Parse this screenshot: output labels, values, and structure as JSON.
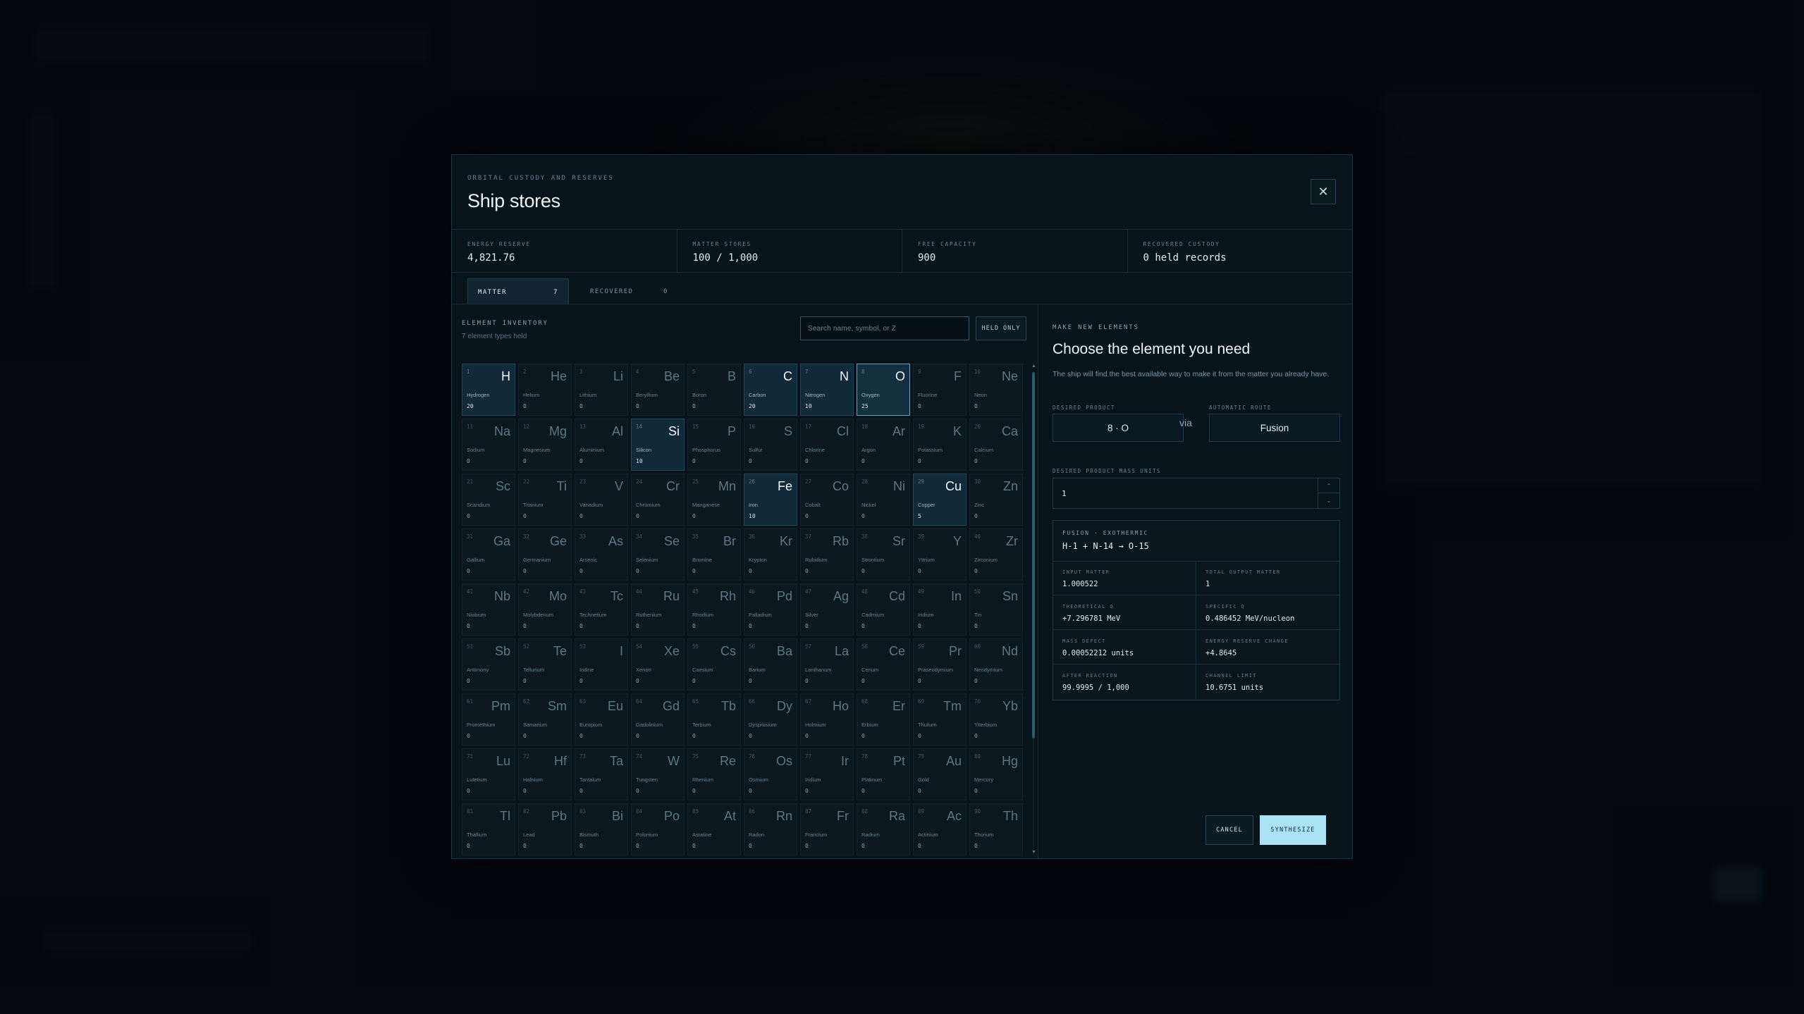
{
  "header": {
    "eyebrow": "ORBITAL CUSTODY AND RESERVES",
    "title": "Ship stores",
    "close_symbol": "✕"
  },
  "stats": [
    {
      "label": "ENERGY RESERVE",
      "value": "4,821.76"
    },
    {
      "label": "MATTER STORES",
      "value": "100 / 1,000"
    },
    {
      "label": "FREE CAPACITY",
      "value": "900"
    },
    {
      "label": "RECOVERED CUSTODY",
      "value": "0 held records"
    }
  ],
  "tabs": [
    {
      "label": "MATTER",
      "count": "7"
    },
    {
      "label": "RECOVERED",
      "count": "0"
    }
  ],
  "inventory": {
    "label": "ELEMENT INVENTORY",
    "sublabel": "7 element types held",
    "search_placeholder": "Search name, symbol, or Z",
    "held_only_label": "HELD ONLY",
    "elements": [
      {
        "z": "1",
        "sym": "H",
        "name": "Hydrogen",
        "qty": "20",
        "state": "held"
      },
      {
        "z": "2",
        "sym": "He",
        "name": "Helium",
        "qty": "0"
      },
      {
        "z": "3",
        "sym": "Li",
        "name": "Lithium",
        "qty": "0"
      },
      {
        "z": "4",
        "sym": "Be",
        "name": "Beryllium",
        "qty": "0"
      },
      {
        "z": "5",
        "sym": "B",
        "name": "Boron",
        "qty": "0"
      },
      {
        "z": "6",
        "sym": "C",
        "name": "Carbon",
        "qty": "20",
        "state": "held"
      },
      {
        "z": "7",
        "sym": "N",
        "name": "Nitrogen",
        "qty": "10",
        "state": "held"
      },
      {
        "z": "8",
        "sym": "O",
        "name": "Oxygen",
        "qty": "25",
        "state": "selected"
      },
      {
        "z": "9",
        "sym": "F",
        "name": "Fluorine",
        "qty": "0"
      },
      {
        "z": "10",
        "sym": "Ne",
        "name": "Neon",
        "qty": "0"
      },
      {
        "z": "11",
        "sym": "Na",
        "name": "Sodium",
        "qty": "0"
      },
      {
        "z": "12",
        "sym": "Mg",
        "name": "Magnesium",
        "qty": "0"
      },
      {
        "z": "13",
        "sym": "Al",
        "name": "Aluminium",
        "qty": "0"
      },
      {
        "z": "14",
        "sym": "Si",
        "name": "Silicon",
        "qty": "10",
        "state": "held"
      },
      {
        "z": "15",
        "sym": "P",
        "name": "Phosphorus",
        "qty": "0"
      },
      {
        "z": "16",
        "sym": "S",
        "name": "Sulfur",
        "qty": "0"
      },
      {
        "z": "17",
        "sym": "Cl",
        "name": "Chlorine",
        "qty": "0"
      },
      {
        "z": "18",
        "sym": "Ar",
        "name": "Argon",
        "qty": "0"
      },
      {
        "z": "19",
        "sym": "K",
        "name": "Potassium",
        "qty": "0"
      },
      {
        "z": "20",
        "sym": "Ca",
        "name": "Calcium",
        "qty": "0"
      },
      {
        "z": "21",
        "sym": "Sc",
        "name": "Scandium",
        "qty": "0"
      },
      {
        "z": "22",
        "sym": "Ti",
        "name": "Titanium",
        "qty": "0"
      },
      {
        "z": "23",
        "sym": "V",
        "name": "Vanadium",
        "qty": "0"
      },
      {
        "z": "24",
        "sym": "Cr",
        "name": "Chromium",
        "qty": "0"
      },
      {
        "z": "25",
        "sym": "Mn",
        "name": "Manganese",
        "qty": "0"
      },
      {
        "z": "26",
        "sym": "Fe",
        "name": "Iron",
        "qty": "10",
        "state": "held"
      },
      {
        "z": "27",
        "sym": "Co",
        "name": "Cobalt",
        "qty": "0"
      },
      {
        "z": "28",
        "sym": "Ni",
        "name": "Nickel",
        "qty": "0"
      },
      {
        "z": "29",
        "sym": "Cu",
        "name": "Copper",
        "qty": "5",
        "state": "held"
      },
      {
        "z": "30",
        "sym": "Zn",
        "name": "Zinc",
        "qty": "0"
      },
      {
        "z": "31",
        "sym": "Ga",
        "name": "Gallium",
        "qty": "0"
      },
      {
        "z": "32",
        "sym": "Ge",
        "name": "Germanium",
        "qty": "0"
      },
      {
        "z": "33",
        "sym": "As",
        "name": "Arsenic",
        "qty": "0"
      },
      {
        "z": "34",
        "sym": "Se",
        "name": "Selenium",
        "qty": "0"
      },
      {
        "z": "35",
        "sym": "Br",
        "name": "Bromine",
        "qty": "0"
      },
      {
        "z": "36",
        "sym": "Kr",
        "name": "Krypton",
        "qty": "0"
      },
      {
        "z": "37",
        "sym": "Rb",
        "name": "Rubidium",
        "qty": "0"
      },
      {
        "z": "38",
        "sym": "Sr",
        "name": "Strontium",
        "qty": "0"
      },
      {
        "z": "39",
        "sym": "Y",
        "name": "Yttrium",
        "qty": "0"
      },
      {
        "z": "40",
        "sym": "Zr",
        "name": "Zirconium",
        "qty": "0"
      },
      {
        "z": "41",
        "sym": "Nb",
        "name": "Niobium",
        "qty": "0"
      },
      {
        "z": "42",
        "sym": "Mo",
        "name": "Molybdenum",
        "qty": "0"
      },
      {
        "z": "43",
        "sym": "Tc",
        "name": "Technetium",
        "qty": "0"
      },
      {
        "z": "44",
        "sym": "Ru",
        "name": "Ruthenium",
        "qty": "0"
      },
      {
        "z": "45",
        "sym": "Rh",
        "name": "Rhodium",
        "qty": "0"
      },
      {
        "z": "46",
        "sym": "Pd",
        "name": "Palladium",
        "qty": "0"
      },
      {
        "z": "47",
        "sym": "Ag",
        "name": "Silver",
        "qty": "0"
      },
      {
        "z": "48",
        "sym": "Cd",
        "name": "Cadmium",
        "qty": "0"
      },
      {
        "z": "49",
        "sym": "In",
        "name": "Indium",
        "qty": "0"
      },
      {
        "z": "50",
        "sym": "Sn",
        "name": "Tin",
        "qty": "0"
      },
      {
        "z": "51",
        "sym": "Sb",
        "name": "Antimony",
        "qty": "0"
      },
      {
        "z": "52",
        "sym": "Te",
        "name": "Tellurium",
        "qty": "0"
      },
      {
        "z": "53",
        "sym": "I",
        "name": "Iodine",
        "qty": "0"
      },
      {
        "z": "54",
        "sym": "Xe",
        "name": "Xenon",
        "qty": "0"
      },
      {
        "z": "55",
        "sym": "Cs",
        "name": "Caesium",
        "qty": "0"
      },
      {
        "z": "56",
        "sym": "Ba",
        "name": "Barium",
        "qty": "0"
      },
      {
        "z": "57",
        "sym": "La",
        "name": "Lanthanum",
        "qty": "0"
      },
      {
        "z": "58",
        "sym": "Ce",
        "name": "Cerium",
        "qty": "0"
      },
      {
        "z": "59",
        "sym": "Pr",
        "name": "Praseodymium",
        "qty": "0"
      },
      {
        "z": "60",
        "sym": "Nd",
        "name": "Neodymium",
        "qty": "0"
      },
      {
        "z": "61",
        "sym": "Pm",
        "name": "Promethium",
        "qty": "0"
      },
      {
        "z": "62",
        "sym": "Sm",
        "name": "Samarium",
        "qty": "0"
      },
      {
        "z": "63",
        "sym": "Eu",
        "name": "Europium",
        "qty": "0"
      },
      {
        "z": "64",
        "sym": "Gd",
        "name": "Gadolinium",
        "qty": "0"
      },
      {
        "z": "65",
        "sym": "Tb",
        "name": "Terbium",
        "qty": "0"
      },
      {
        "z": "66",
        "sym": "Dy",
        "name": "Dysprosium",
        "qty": "0"
      },
      {
        "z": "67",
        "sym": "Ho",
        "name": "Holmium",
        "qty": "0"
      },
      {
        "z": "68",
        "sym": "Er",
        "name": "Erbium",
        "qty": "0"
      },
      {
        "z": "69",
        "sym": "Tm",
        "name": "Thulium",
        "qty": "0"
      },
      {
        "z": "70",
        "sym": "Yb",
        "name": "Ytterbium",
        "qty": "0"
      },
      {
        "z": "71",
        "sym": "Lu",
        "name": "Lutetium",
        "qty": "0"
      },
      {
        "z": "72",
        "sym": "Hf",
        "name": "Hafnium",
        "qty": "0"
      },
      {
        "z": "73",
        "sym": "Ta",
        "name": "Tantalum",
        "qty": "0"
      },
      {
        "z": "74",
        "sym": "W",
        "name": "Tungsten",
        "qty": "0"
      },
      {
        "z": "75",
        "sym": "Re",
        "name": "Rhenium",
        "qty": "0"
      },
      {
        "z": "76",
        "sym": "Os",
        "name": "Osmium",
        "qty": "0"
      },
      {
        "z": "77",
        "sym": "Ir",
        "name": "Iridium",
        "qty": "0"
      },
      {
        "z": "78",
        "sym": "Pt",
        "name": "Platinum",
        "qty": "0"
      },
      {
        "z": "79",
        "sym": "Au",
        "name": "Gold",
        "qty": "0"
      },
      {
        "z": "80",
        "sym": "Hg",
        "name": "Mercury",
        "qty": "0"
      },
      {
        "z": "81",
        "sym": "Tl",
        "name": "Thallium",
        "qty": "0"
      },
      {
        "z": "82",
        "sym": "Pb",
        "name": "Lead",
        "qty": "0"
      },
      {
        "z": "83",
        "sym": "Bi",
        "name": "Bismuth",
        "qty": "0"
      },
      {
        "z": "84",
        "sym": "Po",
        "name": "Polonium",
        "qty": "0"
      },
      {
        "z": "85",
        "sym": "At",
        "name": "Astatine",
        "qty": "0"
      },
      {
        "z": "86",
        "sym": "Rn",
        "name": "Radon",
        "qty": "0"
      },
      {
        "z": "87",
        "sym": "Fr",
        "name": "Francium",
        "qty": "0"
      },
      {
        "z": "88",
        "sym": "Ra",
        "name": "Radium",
        "qty": "0"
      },
      {
        "z": "89",
        "sym": "Ac",
        "name": "Actinium",
        "qty": "0"
      },
      {
        "z": "90",
        "sym": "Th",
        "name": "Thorium",
        "qty": "0"
      }
    ]
  },
  "synth": {
    "eyebrow": "MAKE NEW ELEMENTS",
    "title": "Choose the element you need",
    "description": "The ship will find the best available way to make it from the matter you already have.",
    "product_label": "DESIRED PRODUCT",
    "product_value": "8 · O",
    "via": "via",
    "route_label": "AUTOMATIC ROUTE",
    "route_value": "Fusion",
    "mass_label": "DESIRED PRODUCT MASS UNITS",
    "mass_value": "1",
    "stepper_up": "⌃",
    "stepper_down": "⌄",
    "reaction": {
      "kind": "FUSION · EXOTHERMIC",
      "equation": "H-1 + N-14 → O-15",
      "metrics": [
        {
          "label": "INPUT MATTER",
          "value": "1.000522"
        },
        {
          "label": "TOTAL OUTPUT MATTER",
          "value": "1"
        },
        {
          "label": "THEORETICAL Q",
          "value": "+7.296781 MeV"
        },
        {
          "label": "SPECIFIC Q",
          "value": "0.486452 MeV/nucleon"
        },
        {
          "label": "MASS DEFECT",
          "value": "0.00052212 units"
        },
        {
          "label": "ENERGY RESERVE CHANGE",
          "value": "+4.8645"
        },
        {
          "label": "AFTER REACTION",
          "value": "99.9995 / 1,000"
        },
        {
          "label": "CHANNEL LIMIT",
          "value": "10.6751 units"
        }
      ]
    },
    "cancel_label": "CANCEL",
    "synthesize_label": "SYNTHESIZE"
  },
  "scroll_up": "▲",
  "scroll_down": "▼",
  "colors": {
    "accent": "#a9e3f4",
    "selected_border": "#6f9fba",
    "held_bg": "#102a37"
  }
}
